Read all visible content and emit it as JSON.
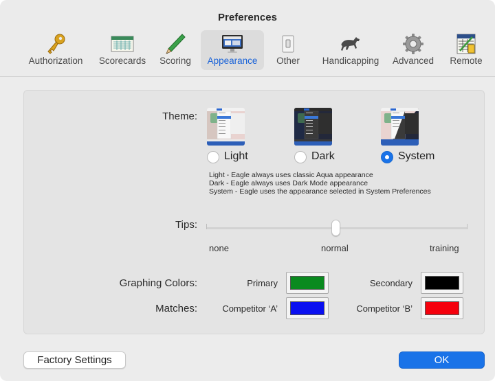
{
  "window": {
    "title": "Preferences"
  },
  "toolbar": {
    "items": [
      {
        "label": "Authorization",
        "icon": "key-icon",
        "selected": false
      },
      {
        "label": "Scorecards",
        "icon": "scorecard-icon",
        "selected": false
      },
      {
        "label": "Scoring",
        "icon": "pencil-icon",
        "selected": false
      },
      {
        "label": "Appearance",
        "icon": "monitor-icon",
        "selected": true
      },
      {
        "label": "Other",
        "icon": "switch-icon",
        "selected": false
      },
      {
        "label": "Handicapping",
        "icon": "horse-icon",
        "selected": false
      },
      {
        "label": "Advanced",
        "icon": "gear-icon",
        "selected": false
      },
      {
        "label": "Remote",
        "icon": "remote-scorecard-icon",
        "selected": false
      }
    ]
  },
  "theme": {
    "label": "Theme:",
    "options": [
      {
        "label": "Light",
        "selected": false
      },
      {
        "label": "Dark",
        "selected": false
      },
      {
        "label": "System",
        "selected": true
      }
    ],
    "description": [
      "Light - Eagle always uses classic Aqua appearance",
      "Dark - Eagle always uses Dark Mode appearance",
      "System - Eagle uses the appearance selected in System Preferences"
    ]
  },
  "tips": {
    "label": "Tips:",
    "stops": [
      "none",
      "normal",
      "training"
    ],
    "value": "normal",
    "value_fraction": 0.5
  },
  "graphing_colors": {
    "label": "Graphing Colors:",
    "primary_label": "Primary",
    "primary_color": "#0a8a1f",
    "secondary_label": "Secondary",
    "secondary_color": "#000000"
  },
  "matches": {
    "label": "Matches:",
    "competitor_a_label": "Competitor ‘A’",
    "competitor_a_color": "#0a10f0",
    "competitor_b_label": "Competitor ‘B’",
    "competitor_b_color": "#f5000c"
  },
  "buttons": {
    "factory_settings": "Factory Settings",
    "ok": "OK"
  },
  "colors": {
    "accent": "#1a73e8",
    "selected_tab_text": "#1a63d8"
  }
}
